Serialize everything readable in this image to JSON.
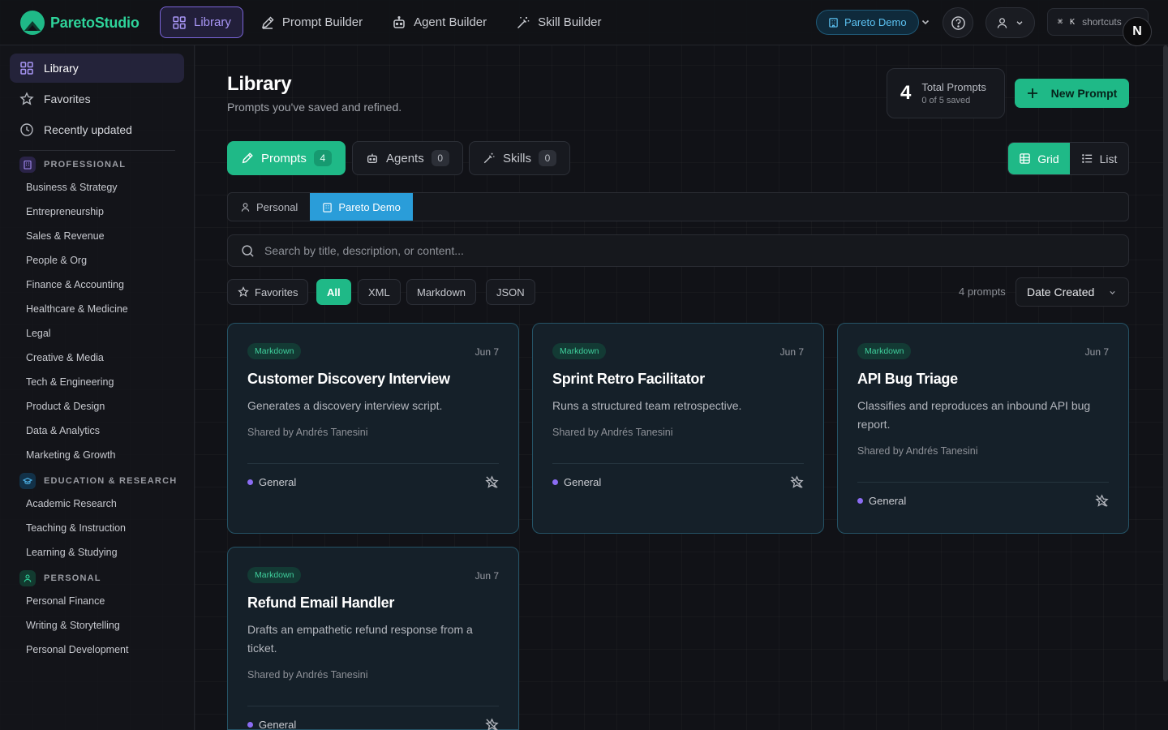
{
  "app": {
    "name": "ParetoStudio"
  },
  "nav": [
    {
      "label": "Library",
      "icon": "grid-icon",
      "active": true
    },
    {
      "label": "Prompt Builder",
      "icon": "pen-icon",
      "active": false
    },
    {
      "label": "Agent Builder",
      "icon": "bot-icon",
      "active": false
    },
    {
      "label": "Skill Builder",
      "icon": "wand-icon",
      "active": false
    }
  ],
  "topbar": {
    "org": "Pareto Demo",
    "shortcut_keys": "⌘",
    "shortcut_letter": "K",
    "shortcut_label": "shortcuts",
    "badge": "N"
  },
  "sidebar": {
    "links": [
      {
        "label": "Library",
        "icon": "grid-icon",
        "active": true
      },
      {
        "label": "Favorites",
        "icon": "star-icon",
        "active": false
      },
      {
        "label": "Recently updated",
        "icon": "clock-icon",
        "active": false
      }
    ],
    "sections": [
      {
        "title": "PROFESSIONAL",
        "icon": "building-icon",
        "color": "#8b6cf3",
        "items": [
          "Business & Strategy",
          "Entrepreneurship",
          "Sales & Revenue",
          "People & Org",
          "Finance & Accounting",
          "Healthcare & Medicine",
          "Legal",
          "Creative & Media",
          "Tech & Engineering",
          "Product & Design",
          "Data & Analytics",
          "Marketing & Growth"
        ]
      },
      {
        "title": "EDUCATION & RESEARCH",
        "icon": "graduation-cap-icon",
        "color": "#2a9dd9",
        "items": [
          "Academic Research",
          "Teaching & Instruction",
          "Learning & Studying"
        ]
      },
      {
        "title": "PERSONAL",
        "icon": "user-icon",
        "color": "#1fb987",
        "items": [
          "Personal Finance",
          "Writing & Storytelling",
          "Personal Development"
        ]
      }
    ]
  },
  "header": {
    "title": "Library",
    "subtitle": "Prompts you've saved and refined.",
    "stat_value": "4",
    "stat_label": "Total Prompts",
    "stat_sub": "0 of 5 saved",
    "new_button": "New Prompt"
  },
  "type_tabs": [
    {
      "label": "Prompts",
      "count": "4",
      "icon": "pen-icon",
      "active": true
    },
    {
      "label": "Agents",
      "count": "0",
      "icon": "bot-icon",
      "active": false
    },
    {
      "label": "Skills",
      "count": "0",
      "icon": "wand-icon",
      "active": false
    }
  ],
  "view": {
    "grid": "Grid",
    "list": "List",
    "active": "grid"
  },
  "scope": [
    {
      "label": "Personal",
      "icon": "user-icon",
      "active": false
    },
    {
      "label": "Pareto Demo",
      "icon": "building-icon",
      "active": true
    }
  ],
  "search": {
    "placeholder": "Search by title, description, or content..."
  },
  "filters": {
    "favorites": "Favorites",
    "formats": [
      {
        "label": "All",
        "active": true
      },
      {
        "label": "XML",
        "active": false
      },
      {
        "label": "Markdown",
        "active": false
      },
      {
        "label": "JSON",
        "active": false
      }
    ],
    "count_text": "4 prompts",
    "sort": "Date Created"
  },
  "cards": [
    {
      "format": "Markdown",
      "date": "Jun 7",
      "title": "Customer Discovery Interview",
      "desc": "Generates a discovery interview script.",
      "shared": "Shared by Andrés Tanesini",
      "category": "General"
    },
    {
      "format": "Markdown",
      "date": "Jun 7",
      "title": "Sprint Retro Facilitator",
      "desc": "Runs a structured team retrospective.",
      "shared": "Shared by Andrés Tanesini",
      "category": "General"
    },
    {
      "format": "Markdown",
      "date": "Jun 7",
      "title": "API Bug Triage",
      "desc": "Classifies and reproduces an inbound API bug report.",
      "shared": "Shared by Andrés Tanesini",
      "category": "General"
    },
    {
      "format": "Markdown",
      "date": "Jun 7",
      "title": "Refund Email Handler",
      "desc": "Drafts an empathetic refund response from a ticket.",
      "shared": "Shared by Andrés Tanesini",
      "category": "General"
    }
  ],
  "colors": {
    "accent": "#1fb987",
    "brand": "#2ed39a",
    "nav_active": "#a896f5",
    "scope_active": "#2a9dd9",
    "card_border": "#255366"
  }
}
